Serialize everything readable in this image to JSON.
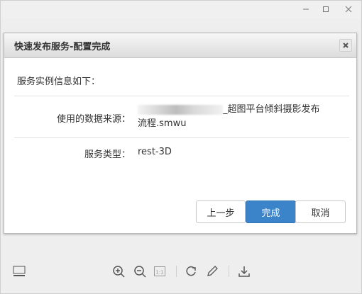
{
  "dialog": {
    "title": "快速发布服务-配置完成",
    "intro": "服务实例信息如下：",
    "rows": [
      {
        "label": "使用的数据来源：",
        "value_line1": "_超图平台倾斜摄影发布",
        "value_line2": "流程.smwu"
      },
      {
        "label": "服务类型：",
        "value_line1": "rest-3D"
      }
    ],
    "buttons": {
      "prev": "上一步",
      "finish": "完成",
      "cancel": "取消"
    }
  },
  "toolbar": {
    "icons": [
      "layout-icon",
      "zoom-in-icon",
      "zoom-out-icon",
      "actual-size-icon",
      "rotate-icon",
      "edit-icon",
      "download-icon"
    ],
    "actual_size_text": "1:1"
  },
  "colors": {
    "primary": "#3c84c9",
    "header_bg": "#dcdcdc"
  }
}
